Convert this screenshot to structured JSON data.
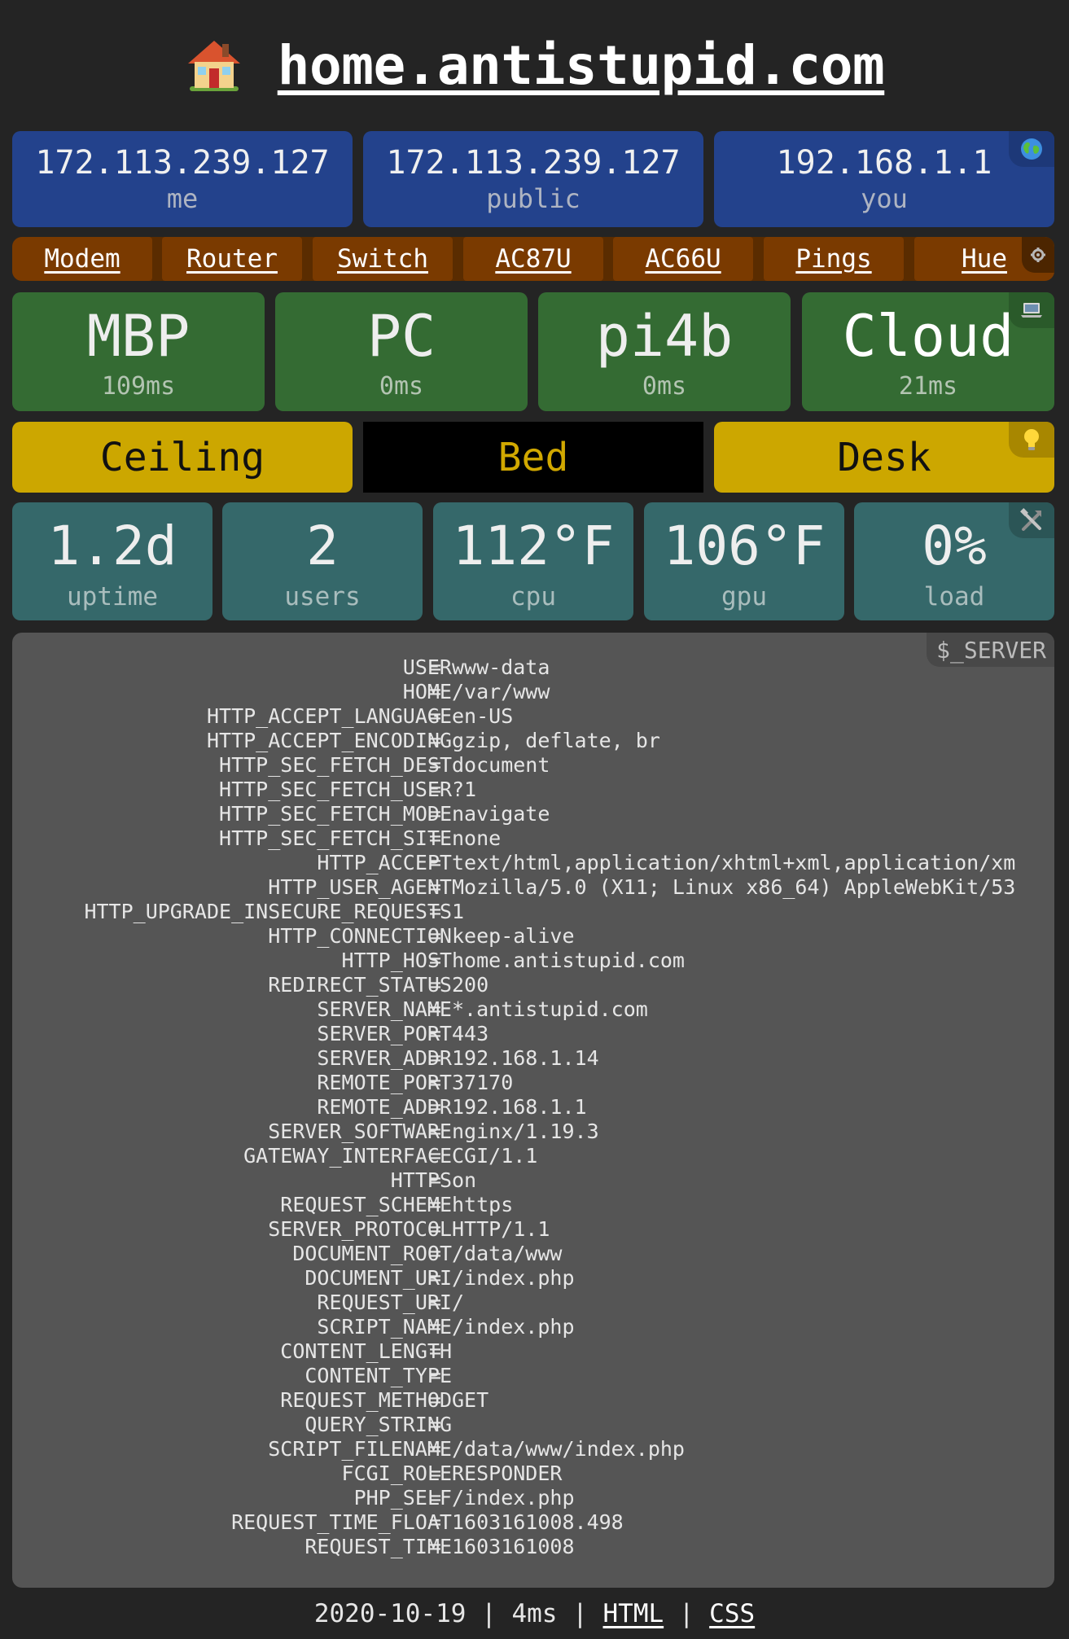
{
  "header": {
    "title": "home.antistupid.com",
    "icon": "house-icon"
  },
  "ips": [
    {
      "value": "172.113.239.127",
      "label": "me"
    },
    {
      "value": "172.113.239.127",
      "label": "public"
    },
    {
      "value": "192.168.1.1",
      "label": "you"
    }
  ],
  "ips_icon": "globe-icon",
  "links": [
    "Modem",
    "Router",
    "Switch",
    "AC87U",
    "AC66U",
    "Pings",
    "Hue"
  ],
  "links_icon": "gear-icon",
  "devices": [
    {
      "name": "MBP",
      "ping": "109ms"
    },
    {
      "name": "PC",
      "ping": "0ms"
    },
    {
      "name": "pi4b",
      "ping": "0ms"
    },
    {
      "name": "Cloud",
      "ping": "21ms"
    }
  ],
  "devices_icon": "laptop-icon",
  "lights": [
    {
      "name": "Ceiling",
      "state": "on"
    },
    {
      "name": "Bed",
      "state": "off"
    },
    {
      "name": "Desk",
      "state": "on"
    }
  ],
  "lights_icon": "lightbulb-icon",
  "stats": [
    {
      "value": "1.2d",
      "label": "uptime"
    },
    {
      "value": "2",
      "label": "users"
    },
    {
      "value": "112°F",
      "label": "cpu"
    },
    {
      "value": "106°F",
      "label": "gpu"
    },
    {
      "value": "0%",
      "label": "load"
    }
  ],
  "stats_icon": "tools-icon",
  "server": {
    "title": "$_SERVER",
    "rows": [
      {
        "k": "USER",
        "v": "www-data"
      },
      {
        "k": "HOME",
        "v": "/var/www"
      },
      {
        "k": "HTTP_ACCEPT_LANGUAGE",
        "v": "en-US"
      },
      {
        "k": "HTTP_ACCEPT_ENCODING",
        "v": "gzip, deflate, br"
      },
      {
        "k": "HTTP_SEC_FETCH_DEST",
        "v": "document"
      },
      {
        "k": "HTTP_SEC_FETCH_USER",
        "v": "?1"
      },
      {
        "k": "HTTP_SEC_FETCH_MODE",
        "v": "navigate"
      },
      {
        "k": "HTTP_SEC_FETCH_SITE",
        "v": "none"
      },
      {
        "k": "HTTP_ACCEPT",
        "v": "text/html,application/xhtml+xml,application/xm"
      },
      {
        "k": "HTTP_USER_AGENT",
        "v": "Mozilla/5.0 (X11; Linux x86_64) AppleWebKit/53"
      },
      {
        "k": "HTTP_UPGRADE_INSECURE_REQUESTS",
        "v": "1"
      },
      {
        "k": "HTTP_CONNECTION",
        "v": "keep-alive"
      },
      {
        "k": "HTTP_HOST",
        "v": "home.antistupid.com"
      },
      {
        "k": "REDIRECT_STATUS",
        "v": "200"
      },
      {
        "k": "SERVER_NAME",
        "v": "*.antistupid.com"
      },
      {
        "k": "SERVER_PORT",
        "v": "443"
      },
      {
        "k": "SERVER_ADDR",
        "v": "192.168.1.14"
      },
      {
        "k": "REMOTE_PORT",
        "v": "37170"
      },
      {
        "k": "REMOTE_ADDR",
        "v": "192.168.1.1"
      },
      {
        "k": "SERVER_SOFTWARE",
        "v": "nginx/1.19.3"
      },
      {
        "k": "GATEWAY_INTERFACE",
        "v": "CGI/1.1"
      },
      {
        "k": "HTTPS",
        "v": "on"
      },
      {
        "k": "REQUEST_SCHEME",
        "v": "https"
      },
      {
        "k": "SERVER_PROTOCOL",
        "v": "HTTP/1.1"
      },
      {
        "k": "DOCUMENT_ROOT",
        "v": "/data/www"
      },
      {
        "k": "DOCUMENT_URI",
        "v": "/index.php"
      },
      {
        "k": "REQUEST_URI",
        "v": "/"
      },
      {
        "k": "SCRIPT_NAME",
        "v": "/index.php"
      },
      {
        "k": "CONTENT_LENGTH",
        "v": ""
      },
      {
        "k": "CONTENT_TYPE",
        "v": ""
      },
      {
        "k": "REQUEST_METHOD",
        "v": "GET"
      },
      {
        "k": "QUERY_STRING",
        "v": ""
      },
      {
        "k": "SCRIPT_FILENAME",
        "v": "/data/www/index.php"
      },
      {
        "k": "FCGI_ROLE",
        "v": "RESPONDER"
      },
      {
        "k": "PHP_SELF",
        "v": "/index.php"
      },
      {
        "k": "REQUEST_TIME_FLOAT",
        "v": "1603161008.498"
      },
      {
        "k": "REQUEST_TIME",
        "v": "1603161008"
      }
    ]
  },
  "footer": {
    "date": "2020-10-19",
    "sep1": "|",
    "time": "4ms",
    "sep2": "|",
    "html_link": "HTML",
    "sep3": "|",
    "css_link": "CSS"
  }
}
